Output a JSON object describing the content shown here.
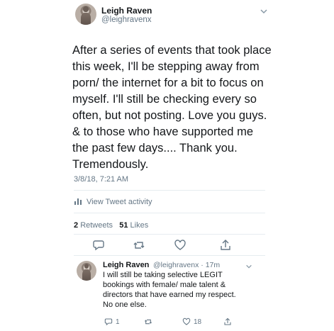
{
  "main_tweet": {
    "name": "Leigh Raven",
    "handle": "@leighravenx",
    "text": "After a series of events that took place\nthis week, I'll be stepping away from\nporn/ the internet for a bit to focus on\nmyself. I'll still be checking every so\noften, but not posting. Love you guys.\n& to those who have supported me\nthe past few days.... Thank you.\nTremendously.",
    "timestamp": "3/8/18, 7:21 AM",
    "activity_label": "View Tweet activity",
    "retweets_count": "2",
    "retweets_label": "Retweets",
    "likes_count": "51",
    "likes_label": "Likes"
  },
  "reply": {
    "name": "Leigh Raven",
    "handle_time": "@leighravenx · 17m",
    "text": "I will still be taking selective LEGIT\nbookings with female/ male talent &\ndirectors that have earned my respect.\nNo one else.",
    "reply_count": "1",
    "like_count": "18"
  },
  "icons": {
    "reply": "speech-bubble-icon",
    "retweet": "retweet-icon",
    "like": "heart-icon",
    "share": "share-icon",
    "chevron": "chevron-down-icon",
    "activity": "bar-chart-icon"
  },
  "colors": {
    "text": "#14171a",
    "secondary": "#657786",
    "divider": "#e6ecf0"
  }
}
